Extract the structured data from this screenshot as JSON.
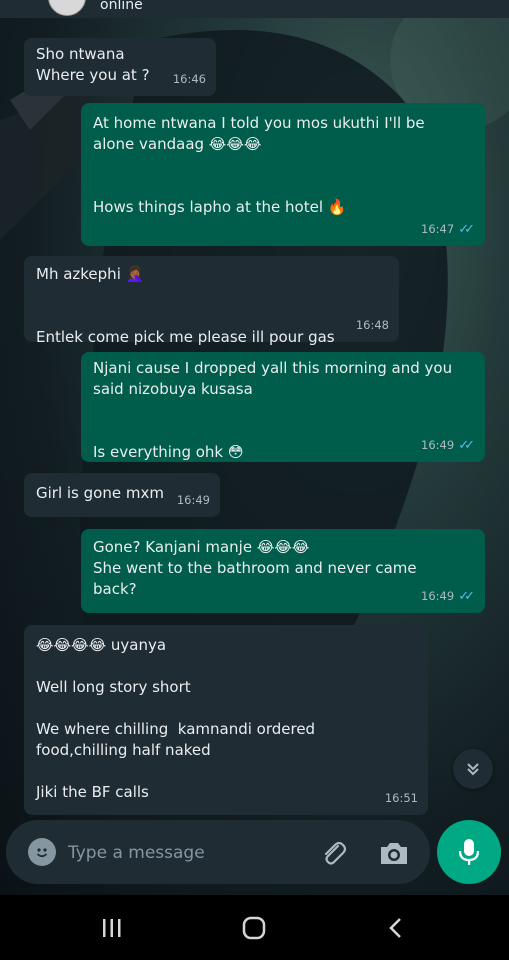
{
  "header": {
    "status": "online"
  },
  "messages": [
    {
      "dir": "in",
      "lines": "Sho ntwana\nWhere you at ?",
      "time": "16:46"
    },
    {
      "dir": "out",
      "lines": "At home ntwana I told you mos ukuthi I'll be\nalone vandaag 😂😂😂\n\n\nHows things lapho at the hotel 🔥",
      "time": "16:47"
    },
    {
      "dir": "in",
      "lines": "Mh azkephi 🤦🏾‍♀️\n\n\nEntlek come pick me please ill pour gas",
      "time": "16:48"
    },
    {
      "dir": "out",
      "lines": "Njani cause I dropped yall this morning and you\nsaid nizobuya kusasa\n\n\nIs everything ohk 😳",
      "time": "16:49"
    },
    {
      "dir": "in",
      "lines": "Girl is gone mxm",
      "time": "16:49"
    },
    {
      "dir": "out",
      "lines": "Gone? Kanjani manje 😂😂😂\nShe went to the bathroom and never came\nback?",
      "time": "16:49"
    },
    {
      "dir": "in",
      "lines": "😂😂😂😂 uyanya\n\nWell long story short\n\nWe where chilling  kamnandi ordered\nfood,chilling half naked\n\nJiki the BF calls",
      "time": "16:51"
    }
  ],
  "composer": {
    "placeholder": "Type a message"
  },
  "icons": {
    "scroll": "chevron-double-down-icon",
    "emoji": "emoji-icon",
    "attach": "paperclip-icon",
    "camera": "camera-icon",
    "mic": "microphone-icon",
    "nav": [
      "recent-apps-icon",
      "home-icon",
      "back-icon"
    ]
  },
  "colors": {
    "incoming": "#1f2c33",
    "outgoing": "#005c4b",
    "accent": "#00a884",
    "read_ticks": "#53bdeb"
  }
}
